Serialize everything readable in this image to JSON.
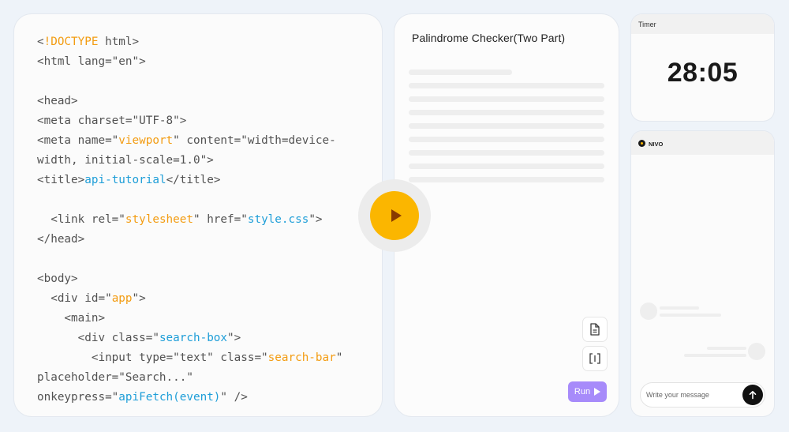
{
  "code": {
    "lines": [
      [
        {
          "t": "<"
        },
        {
          "t": "!DOCTYPE",
          "c": "orange"
        },
        {
          "t": " html>"
        }
      ],
      [
        {
          "t": "<html lang=\"en\">"
        }
      ],
      [],
      [
        {
          "t": "<head>"
        }
      ],
      [
        {
          "t": "<meta charset=\"UTF-8\">"
        }
      ],
      [
        {
          "t": "<meta name=\""
        },
        {
          "t": "viewport",
          "c": "orange"
        },
        {
          "t": "\" content=\"width=device-"
        }
      ],
      [
        {
          "t": "width, initial-scale=1.0\">"
        }
      ],
      [
        {
          "t": "<title>"
        },
        {
          "t": "api-tutorial",
          "c": "blue"
        },
        {
          "t": "</title>"
        }
      ],
      [],
      [
        {
          "t": "  <link rel=\""
        },
        {
          "t": "stylesheet",
          "c": "orange"
        },
        {
          "t": "\" href=\""
        },
        {
          "t": "style.css",
          "c": "blue"
        },
        {
          "t": "\">"
        }
      ],
      [
        {
          "t": "</head>"
        }
      ],
      [],
      [
        {
          "t": "<body>"
        }
      ],
      [
        {
          "t": "  <div id=\""
        },
        {
          "t": "app",
          "c": "orange"
        },
        {
          "t": "\">"
        }
      ],
      [
        {
          "t": "    <main>"
        }
      ],
      [
        {
          "t": "      <div class=\""
        },
        {
          "t": "search-box",
          "c": "blue"
        },
        {
          "t": "\">"
        }
      ],
      [
        {
          "t": "        <input type=\"text\" class=\""
        },
        {
          "t": "search-bar",
          "c": "orange"
        },
        {
          "t": "\""
        }
      ],
      [
        {
          "t": "placeholder=\"Search...\""
        }
      ],
      [
        {
          "t": "onkeypress=\""
        },
        {
          "t": "apiFetch(event)",
          "c": "blue"
        },
        {
          "t": "\" />"
        }
      ]
    ]
  },
  "problem": {
    "title": "Palindrome Checker(Two Part)",
    "run_label": "Run"
  },
  "timer": {
    "label": "Timer",
    "value": "28:05"
  },
  "chat": {
    "name": "NIVO",
    "input_placeholder": "Write your message"
  },
  "colors": {
    "accent": "#fbb600",
    "run": "#a78bfa",
    "token_orange": "#f39c12",
    "token_blue": "#1e9ed8"
  }
}
